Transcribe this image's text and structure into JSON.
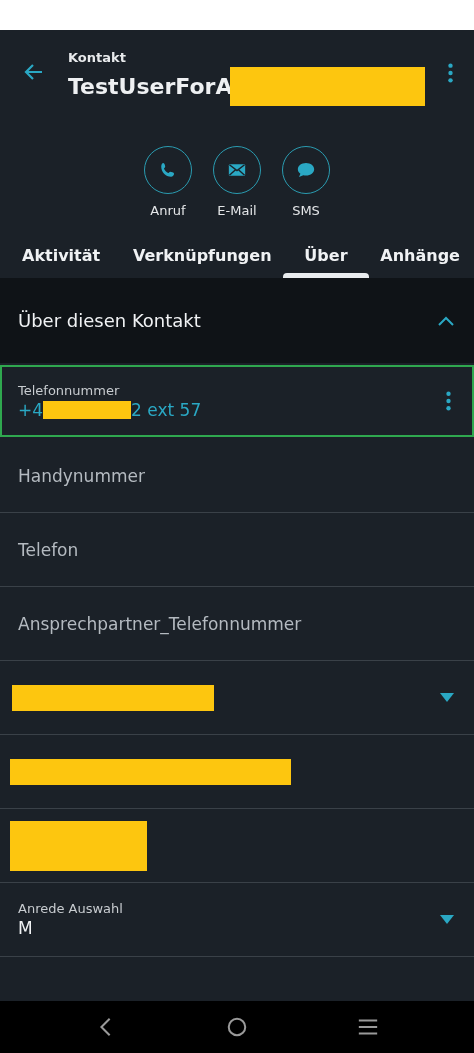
{
  "header": {
    "subtitle": "Kontakt",
    "title": "TestUserForA",
    "title_redacted": true
  },
  "actions": [
    {
      "kind": "phone",
      "label": "Anruf"
    },
    {
      "kind": "mail",
      "label": "E-Mail"
    },
    {
      "kind": "chat",
      "label": "SMS"
    }
  ],
  "tabs": [
    {
      "label": "Aktivität",
      "selected": false
    },
    {
      "label": "Verknüpfungen",
      "selected": false
    },
    {
      "label": "Über",
      "selected": true
    },
    {
      "label": "Anhänge",
      "selected": false
    }
  ],
  "section": {
    "title": "Über diesen Kontakt",
    "expanded": true
  },
  "rows": [
    {
      "kind": "field",
      "label": "Telefonnummer",
      "value_start": "+4",
      "value_end": "2 ext 57",
      "focused": true,
      "menu": true
    },
    {
      "kind": "empty",
      "label": "Handynummer",
      "focused": false
    },
    {
      "kind": "empty",
      "label": "Telefon",
      "focused": false
    },
    {
      "kind": "empty",
      "label": "Ansprechpartner_Telefonnummer",
      "focused": false
    },
    {
      "kind": "redacted",
      "dropdown": true,
      "focused": false
    },
    {
      "kind": "redacted",
      "dropdown": false,
      "focused": false
    },
    {
      "kind": "redacted",
      "dropdown": false,
      "focused": false
    },
    {
      "kind": "select",
      "label": "Anrede Auswahl",
      "value": "M",
      "dropdown": true,
      "focused": false
    }
  ]
}
